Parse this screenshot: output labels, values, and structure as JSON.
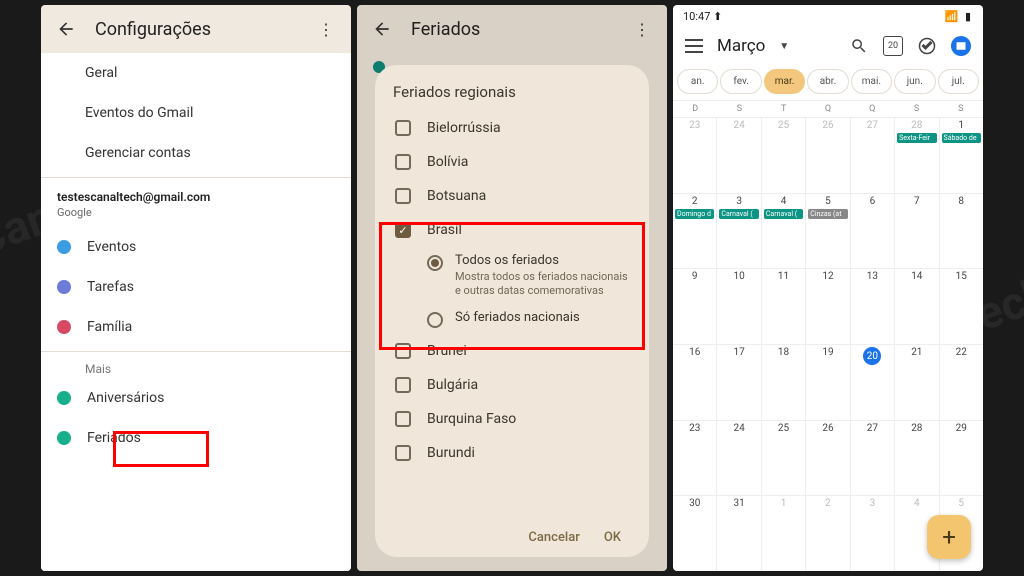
{
  "panel1": {
    "title": "Configurações",
    "items_top": [
      "Geral",
      "Eventos do Gmail",
      "Gerenciar contas"
    ],
    "account": {
      "email": "testescanaltech@gmail.com",
      "provider": "Google"
    },
    "cal_items": [
      {
        "label": "Eventos",
        "color": "#3b9de3"
      },
      {
        "label": "Tarefas",
        "color": "#6b7bd6"
      },
      {
        "label": "Família",
        "color": "#d64a63"
      }
    ],
    "more_label": "Mais",
    "more_items": [
      {
        "label": "Aniversários",
        "color": "#18b08a"
      },
      {
        "label": "Feriados",
        "color": "#18b08a"
      }
    ]
  },
  "panel2": {
    "title": "Feriados",
    "dialog_title": "Feriados regionais",
    "countries": [
      {
        "label": "Bielorrússia",
        "checked": false
      },
      {
        "label": "Bolívia",
        "checked": false
      },
      {
        "label": "Botsuana",
        "checked": false
      },
      {
        "label": "Brasil",
        "checked": true
      },
      {
        "label": "Brunei",
        "checked": false
      },
      {
        "label": "Bulgária",
        "checked": false
      },
      {
        "label": "Burquina Faso",
        "checked": false
      },
      {
        "label": "Burundi",
        "checked": false
      }
    ],
    "brasil_opts": [
      {
        "label": "Todos os feriados",
        "desc": "Mostra todos os feriados nacionais e outras datas comemorativas",
        "selected": true
      },
      {
        "label": "Só feriados nacionais",
        "desc": "",
        "selected": false
      }
    ],
    "cancel": "Cancelar",
    "ok": "OK"
  },
  "panel3": {
    "time": "10:47",
    "month": "Março",
    "today_box": "20",
    "month_tabs": [
      "an.",
      "fev.",
      "mar.",
      "abr.",
      "mai.",
      "jun.",
      "jul."
    ],
    "month_selected": 2,
    "dow": [
      "D",
      "S",
      "T",
      "Q",
      "Q",
      "S",
      "S"
    ],
    "weeks": [
      [
        {
          "n": "23",
          "fade": true
        },
        {
          "n": "24",
          "fade": true
        },
        {
          "n": "25",
          "fade": true
        },
        {
          "n": "26",
          "fade": true
        },
        {
          "n": "27",
          "fade": true
        },
        {
          "n": "28",
          "fade": true,
          "ev": [
            {
              "t": "Sexta-Feir"
            }
          ]
        },
        {
          "n": "1",
          "ev": [
            {
              "t": "Sábado de"
            }
          ]
        }
      ],
      [
        {
          "n": "2",
          "ev": [
            {
              "t": "Domingo d"
            }
          ]
        },
        {
          "n": "3",
          "ev": [
            {
              "t": "Carnaval ("
            }
          ]
        },
        {
          "n": "4",
          "ev": [
            {
              "t": "Carnaval ("
            }
          ]
        },
        {
          "n": "5",
          "ev": [
            {
              "t": "Cinzas (at",
              "g": true
            }
          ]
        },
        {
          "n": "6"
        },
        {
          "n": "7"
        },
        {
          "n": "8"
        }
      ],
      [
        {
          "n": "9"
        },
        {
          "n": "10"
        },
        {
          "n": "11"
        },
        {
          "n": "12"
        },
        {
          "n": "13"
        },
        {
          "n": "14"
        },
        {
          "n": "15"
        }
      ],
      [
        {
          "n": "16"
        },
        {
          "n": "17"
        },
        {
          "n": "18"
        },
        {
          "n": "19"
        },
        {
          "n": "20",
          "today": true
        },
        {
          "n": "21"
        },
        {
          "n": "22"
        }
      ],
      [
        {
          "n": "23"
        },
        {
          "n": "24"
        },
        {
          "n": "25"
        },
        {
          "n": "26"
        },
        {
          "n": "27"
        },
        {
          "n": "28"
        },
        {
          "n": "29"
        }
      ],
      [
        {
          "n": "30"
        },
        {
          "n": "31"
        },
        {
          "n": "1",
          "fade": true
        },
        {
          "n": "2",
          "fade": true
        },
        {
          "n": "3",
          "fade": true
        },
        {
          "n": "4",
          "fade": true
        },
        {
          "n": "5",
          "fade": true
        }
      ]
    ],
    "fab": "+"
  }
}
